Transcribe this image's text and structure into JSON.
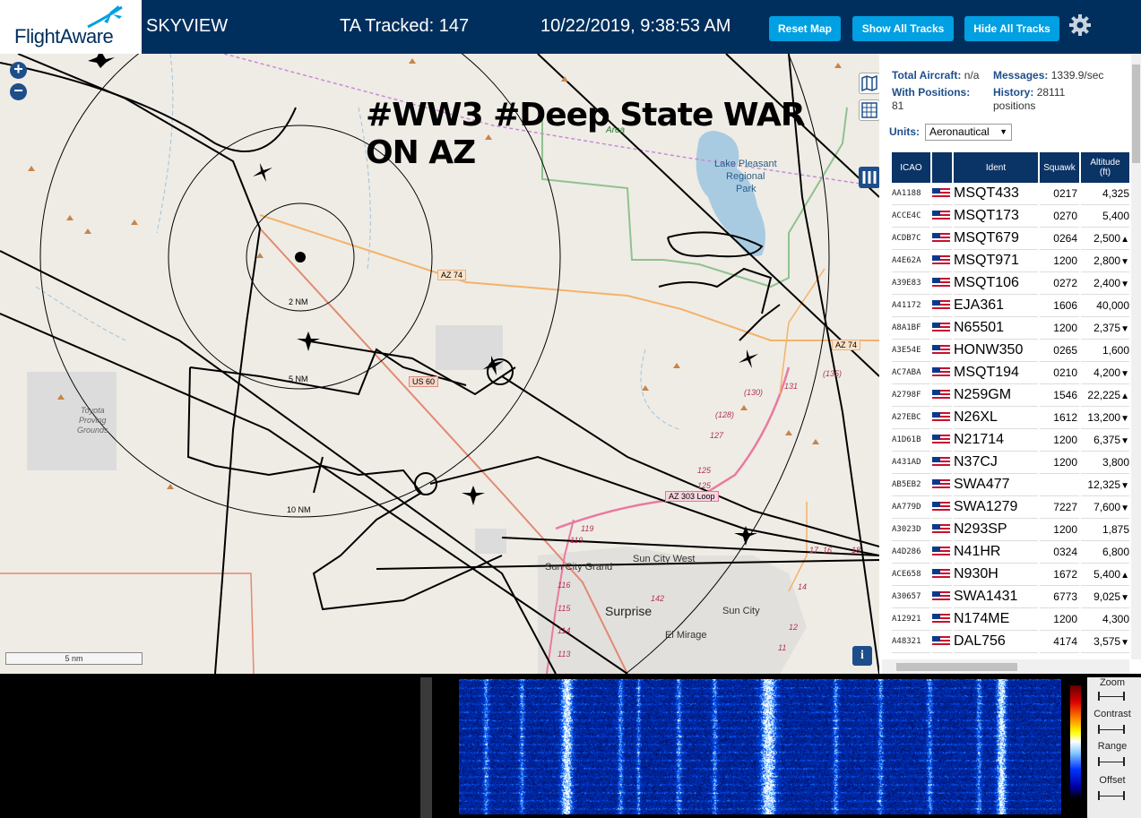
{
  "header": {
    "brand": "FlightAware",
    "app_title": "SKYVIEW",
    "tracked": "TA Tracked: 147",
    "datetime": "10/22/2019, 9:38:53 AM",
    "buttons": {
      "reset": "Reset Map",
      "show_all": "Show All Tracks",
      "hide_all": "Hide All Tracks"
    },
    "colors": {
      "bar": "#002f5d",
      "button": "#00a0e2"
    }
  },
  "map": {
    "annotation_line1": "#WW3 #Deep State WAR",
    "annotation_line2": "ON AZ",
    "scale_label": "5 nm",
    "range_rings": [
      "2 NM",
      "5 NM",
      "10 NM"
    ],
    "labels": {
      "lake": "Lake Pleasant",
      "regional": "Regional",
      "park": "Park",
      "area": "Area",
      "toyota1": "Toyota",
      "toyota2": "Proving",
      "toyota3": "Grounds",
      "az74a": "AZ 74",
      "az74b": "AZ 74",
      "us60": "US 60",
      "az303": "AZ 303 Loop",
      "sun_city_grand": "Sun City Grand",
      "sun_city_west": "Sun City West",
      "surprise": "Surprise",
      "sun_city": "Sun City",
      "el_mirage": "El Mirage",
      "r130": "(130)",
      "r131": "131",
      "r135": "(135)",
      "r128": "(128)",
      "r127": "127",
      "r125a": "125",
      "r125b": "125",
      "r119a": "119",
      "r119b": "119",
      "r116": "116",
      "r115": "115",
      "r114": "114",
      "r113": "113",
      "r142": "142",
      "r14": "14",
      "r12": "12",
      "r11": "11",
      "r17": "17",
      "r16": "16",
      "r18": "18"
    },
    "info_glyph": "i"
  },
  "panel": {
    "total_label": "Total Aircraft:",
    "total_value": "n/a",
    "messages_label": "Messages:",
    "messages_value": "1339.9/sec",
    "positions_label": "With Positions:",
    "positions_value": "81",
    "history_label": "History:",
    "history_value": "28111",
    "history_unit": "positions",
    "units_label": "Units:",
    "units_value": "Aeronautical",
    "columns": {
      "icao": "ICAO",
      "ident": "Ident",
      "squawk": "Squawk",
      "alt1": "Altitude",
      "alt2": "(ft)"
    },
    "rows": [
      {
        "icao": "AA1188",
        "ident": "MSQT433",
        "squawk": "0217",
        "alt": "4,325",
        "trend": ""
      },
      {
        "icao": "ACCE4C",
        "ident": "MSQT173",
        "squawk": "0270",
        "alt": "5,400",
        "trend": ""
      },
      {
        "icao": "ACDB7C",
        "ident": "MSQT679",
        "squawk": "0264",
        "alt": "2,500",
        "trend": "▲"
      },
      {
        "icao": "A4E62A",
        "ident": "MSQT971",
        "squawk": "1200",
        "alt": "2,800",
        "trend": "▼"
      },
      {
        "icao": "A39E83",
        "ident": "MSQT106",
        "squawk": "0272",
        "alt": "2,400",
        "trend": "▼"
      },
      {
        "icao": "A41172",
        "ident": "EJA361",
        "squawk": "1606",
        "alt": "40,000",
        "trend": ""
      },
      {
        "icao": "A8A1BF",
        "ident": "N65501",
        "squawk": "1200",
        "alt": "2,375",
        "trend": "▼"
      },
      {
        "icao": "A3E54E",
        "ident": "HONW350",
        "squawk": "0265",
        "alt": "1,600",
        "trend": ""
      },
      {
        "icao": "AC7ABA",
        "ident": "MSQT194",
        "squawk": "0210",
        "alt": "4,200",
        "trend": "▼"
      },
      {
        "icao": "A2798F",
        "ident": "N259GM",
        "squawk": "1546",
        "alt": "22,225",
        "trend": "▲"
      },
      {
        "icao": "A27EBC",
        "ident": "N26XL",
        "squawk": "1612",
        "alt": "13,200",
        "trend": "▼"
      },
      {
        "icao": "A1D61B",
        "ident": "N21714",
        "squawk": "1200",
        "alt": "6,375",
        "trend": "▼"
      },
      {
        "icao": "A431AD",
        "ident": "N37CJ",
        "squawk": "1200",
        "alt": "3,800",
        "trend": ""
      },
      {
        "icao": "AB5EB2",
        "ident": "SWA477",
        "squawk": "",
        "alt": "12,325",
        "trend": "▼"
      },
      {
        "icao": "AA779D",
        "ident": "SWA1279",
        "squawk": "7227",
        "alt": "7,600",
        "trend": "▼"
      },
      {
        "icao": "A3023D",
        "ident": "N293SP",
        "squawk": "1200",
        "alt": "1,875",
        "trend": ""
      },
      {
        "icao": "A4D286",
        "ident": "N41HR",
        "squawk": "0324",
        "alt": "6,800",
        "trend": ""
      },
      {
        "icao": "ACE658",
        "ident": "N930H",
        "squawk": "1672",
        "alt": "5,400",
        "trend": "▲"
      },
      {
        "icao": "A30657",
        "ident": "SWA1431",
        "squawk": "6773",
        "alt": "9,025",
        "trend": "▼"
      },
      {
        "icao": "A12921",
        "ident": "N174ME",
        "squawk": "1200",
        "alt": "4,300",
        "trend": ""
      },
      {
        "icao": "A48321",
        "ident": "DAL756",
        "squawk": "4174",
        "alt": "3,575",
        "trend": "▼"
      }
    ]
  },
  "spectrum_controls": {
    "zoom": "Zoom",
    "contrast": "Contrast",
    "range": "Range",
    "offset": "Offset"
  }
}
